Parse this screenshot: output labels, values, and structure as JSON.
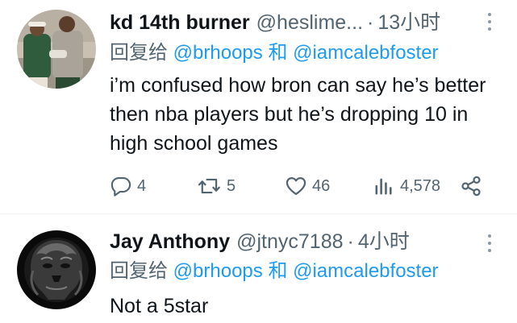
{
  "tweets": [
    {
      "name": "kd 14th burner",
      "handle": "@heslime...",
      "dot": "·",
      "time": "13小时",
      "reply_prefix": "回复给",
      "reply_user_1": "@brhoops",
      "reply_joiner": "和",
      "reply_user_2": "@iamcalebfoster",
      "text": "i’m confused how bron can say he’s better then nba players but he’s dropping 10 in high school games",
      "stats": {
        "replies": "4",
        "retweets": "5",
        "likes": "46",
        "views": "4,578"
      }
    },
    {
      "name": "Jay Anthony",
      "handle": "@jtnyc7188",
      "dot": "·",
      "time": "4小时",
      "reply_prefix": "回复给",
      "reply_user_1": "@brhoops",
      "reply_joiner": "和",
      "reply_user_2": "@iamcalebfoster",
      "text": "Not a 5star"
    }
  ],
  "icons": {
    "reply": "reply-bubble-icon",
    "retweet": "retweet-icon",
    "like": "heart-icon",
    "views": "views-bar-chart-icon",
    "share": "share-icon",
    "more": "more-vertical-icon"
  },
  "colors": {
    "text": "#0f1419",
    "muted": "#536471",
    "link": "#1d9bf0",
    "divider": "#eff3f4"
  }
}
